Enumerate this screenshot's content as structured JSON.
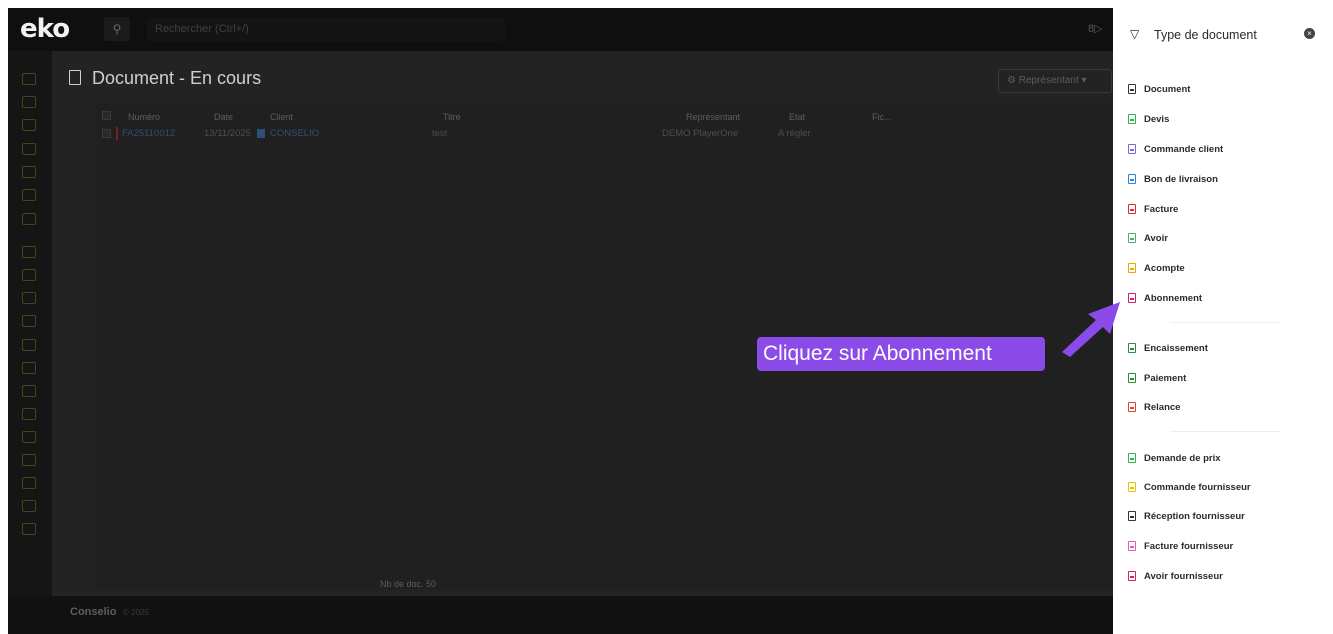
{
  "app": {
    "logo": "eko",
    "search_placeholder": "Rechercher (Ctrl+/)"
  },
  "page": {
    "title": "Document - En cours",
    "representative_button": "Représentant"
  },
  "table": {
    "headers": [
      "Numéro",
      "Date",
      "Client",
      "Titre",
      "Représentant",
      "Etat",
      "Fic..."
    ],
    "rows": [
      {
        "numero": "FA25110012",
        "date": "13/11/2025",
        "client": "CONSELIO",
        "titre": "test",
        "representant": "DEMO PlayerOne",
        "etat": "A régler"
      }
    ],
    "count_label": "Nb de doc. 50"
  },
  "footer": {
    "brand": "Conselio",
    "year": "© 2025"
  },
  "panel": {
    "title": "Type de document",
    "group1": [
      {
        "label": "Document",
        "color": "#333333"
      },
      {
        "label": "Devis",
        "color": "#2fb54a"
      },
      {
        "label": "Commande client",
        "color": "#7a6bd0"
      },
      {
        "label": "Bon de livraison",
        "color": "#2e86de"
      },
      {
        "label": "Facture",
        "color": "#d72e2e"
      },
      {
        "label": "Avoir",
        "color": "#4caf6a"
      },
      {
        "label": "Acompte",
        "color": "#e9a800"
      },
      {
        "label": "Abonnement",
        "color": "#d4206a"
      }
    ],
    "group2": [
      {
        "label": "Encaissement",
        "color": "#2e8b3c"
      },
      {
        "label": "Paiement",
        "color": "#2e8b3c"
      },
      {
        "label": "Relance",
        "color": "#e0452e"
      }
    ],
    "group3": [
      {
        "label": "Demande de prix",
        "color": "#2fb54a"
      },
      {
        "label": "Commande fournisseur",
        "color": "#e9c400"
      },
      {
        "label": "Réception fournisseur",
        "color": "#333333"
      },
      {
        "label": "Facture fournisseur",
        "color": "#e65bb8"
      },
      {
        "label": "Avoir fournisseur",
        "color": "#d4206a"
      }
    ]
  },
  "callout": {
    "text": "Cliquez sur Abonnement",
    "color": "#8b4be8"
  }
}
